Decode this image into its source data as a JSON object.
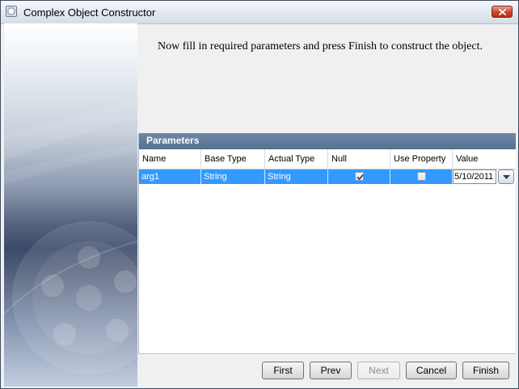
{
  "window": {
    "title": "Complex Object Constructor",
    "icons": {
      "app": "app-icon",
      "close": "close-icon"
    }
  },
  "instructions": "Now fill in required parameters and press Finish to construct the object.",
  "parameters": {
    "header": "Parameters",
    "columns": [
      "Name",
      "Base Type",
      "Actual Type",
      "Null",
      "Use Property",
      "Value"
    ],
    "rows": [
      {
        "name": "arg1",
        "base_type": "String",
        "actual_type": "String",
        "null": true,
        "use_property": false,
        "value": "5/10/2011",
        "selected": true
      }
    ]
  },
  "buttons": {
    "first": "First",
    "prev": "Prev",
    "next": "Next",
    "cancel": "Cancel",
    "finish": "Finish"
  },
  "colors": {
    "header_bg": "#6780a0",
    "selection": "#3399ff"
  }
}
